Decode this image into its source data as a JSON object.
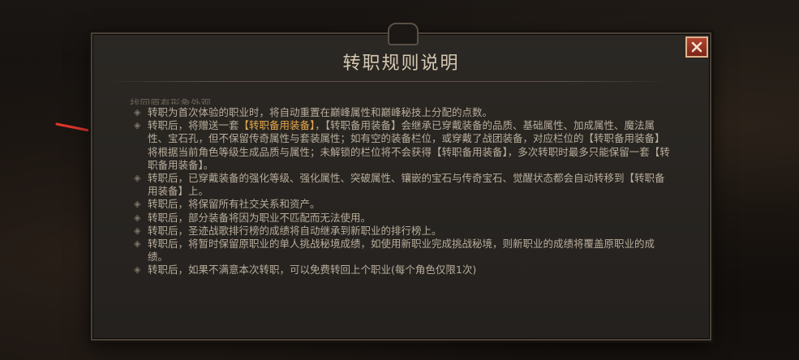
{
  "dialog": {
    "title": "转职规则说明",
    "cutoff_line": "找回原有形象外观。"
  },
  "rules": [
    {
      "segments": [
        {
          "t": "转职为首次体验的职业时，将自动重置在巅峰属性和巅峰秘技上分配的点数。",
          "hl": false
        }
      ]
    },
    {
      "segments": [
        {
          "t": "转职后，将赠送一套",
          "hl": false
        },
        {
          "t": "【转职备用装备】",
          "hl": true
        },
        {
          "t": "，【转职备用装备】会继承已穿戴装备的品质、基础属性、加成属性、魔法属性、宝石孔，但不保留传奇属性与套装属性；如有空的装备栏位，或穿戴了战团装备，对应栏位的【转职备用装备】将根据当前角色等级生成品质与属性；未解锁的栏位将不会获得【转职备用装备】，多次转职时最多只能保留一套【转职备用装备】。",
          "hl": false
        }
      ]
    },
    {
      "segments": [
        {
          "t": "转职后，已穿戴装备的强化等级、强化属性、突破属性、镶嵌的宝石与传奇宝石、觉醒状态都会自动转移到【转职备用装备】上。",
          "hl": false
        }
      ]
    },
    {
      "segments": [
        {
          "t": "转职后，将保留所有社交关系和资产。",
          "hl": false
        }
      ]
    },
    {
      "segments": [
        {
          "t": "转职后，部分装备将因为职业不匹配而无法使用。",
          "hl": false
        }
      ]
    },
    {
      "segments": [
        {
          "t": "转职后，圣迹战歌排行榜的成绩将自动继承到新职业的排行榜上。",
          "hl": false
        }
      ]
    },
    {
      "segments": [
        {
          "t": "转职后，将暂时保留原职业的单人挑战秘境成绩，如使用新职业完成挑战秘境，则新职业的成绩将覆盖原职业的成绩。",
          "hl": false
        }
      ]
    },
    {
      "segments": [
        {
          "t": "转职后，如果不满意本次转职，可以免费转回上个职业(每个角色仅限1次)",
          "hl": false
        }
      ]
    }
  ],
  "colors": {
    "highlight": "#e8a94a",
    "body_text": "#b8ad9c",
    "arrow": "#e0362c",
    "close_button": "#a23a28"
  },
  "icons": {
    "close": "close-icon",
    "bullet": "diamond-bullet-icon",
    "arrow": "red-arrow-annotation"
  }
}
